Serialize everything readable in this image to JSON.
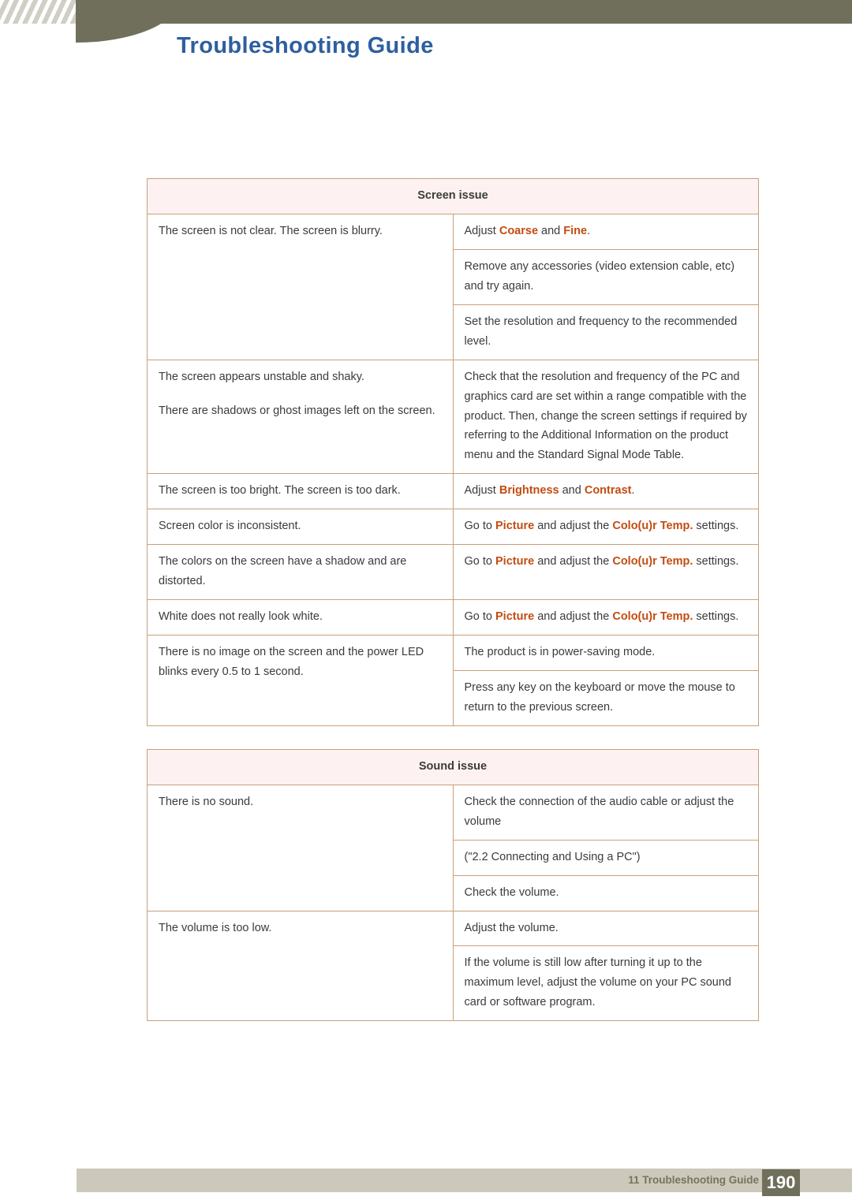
{
  "header": {
    "title": "Troubleshooting Guide"
  },
  "tables": [
    {
      "section": "Screen issue",
      "rows": [
        {
          "problem": [
            "The screen is not clear. The screen is blurry."
          ],
          "solutions": [
            [
              {
                "t": "Adjust ",
                "em": false
              },
              {
                "t": "Coarse",
                "em": true
              },
              {
                "t": " and ",
                "em": false
              },
              {
                "t": "Fine",
                "em": true
              },
              {
                "t": ".",
                "em": false
              }
            ],
            [
              {
                "t": "Remove any accessories (video extension cable, etc) and try again.",
                "em": false
              }
            ],
            [
              {
                "t": "Set the resolution and frequency to the recommended level.",
                "em": false
              }
            ]
          ]
        },
        {
          "problem": [
            "The screen appears unstable and shaky.",
            "There are shadows or ghost images left on the screen."
          ],
          "solutions": [
            [
              {
                "t": "Check that the resolution and frequency of the PC and graphics card are set within a range compatible with the product. Then, change the screen settings if required by referring to the Additional Information on the product menu and the Standard Signal Mode Table.",
                "em": false
              }
            ]
          ]
        },
        {
          "problem": [
            "The screen is too bright. The screen is too dark."
          ],
          "solutions": [
            [
              {
                "t": "Adjust ",
                "em": false
              },
              {
                "t": "Brightness",
                "em": true
              },
              {
                "t": " and ",
                "em": false
              },
              {
                "t": "Contrast",
                "em": true
              },
              {
                "t": ".",
                "em": false
              }
            ]
          ]
        },
        {
          "problem": [
            "Screen color is inconsistent."
          ],
          "solutions": [
            [
              {
                "t": "Go to ",
                "em": false
              },
              {
                "t": "Picture",
                "em": true
              },
              {
                "t": " and adjust the ",
                "em": false
              },
              {
                "t": "Colo(u)r Temp.",
                "em": true
              },
              {
                "t": " settings.",
                "em": false
              }
            ]
          ]
        },
        {
          "problem": [
            "The colors on the screen have a shadow and are distorted."
          ],
          "solutions": [
            [
              {
                "t": "Go to ",
                "em": false
              },
              {
                "t": "Picture",
                "em": true
              },
              {
                "t": " and adjust the ",
                "em": false
              },
              {
                "t": "Colo(u)r Temp.",
                "em": true
              },
              {
                "t": " settings.",
                "em": false
              }
            ]
          ]
        },
        {
          "problem": [
            "White does not really look white."
          ],
          "solutions": [
            [
              {
                "t": "Go to ",
                "em": false
              },
              {
                "t": "Picture",
                "em": true
              },
              {
                "t": " and adjust the ",
                "em": false
              },
              {
                "t": "Colo(u)r Temp.",
                "em": true
              },
              {
                "t": " settings.",
                "em": false
              }
            ]
          ]
        },
        {
          "problem": [
            "There is no image on the screen and the power LED blinks every 0.5 to 1 second."
          ],
          "solutions": [
            [
              {
                "t": "The product is in power-saving mode.",
                "em": false
              }
            ],
            [
              {
                "t": "Press any key on the keyboard or move the mouse to return to the previous screen.",
                "em": false
              }
            ]
          ]
        }
      ]
    },
    {
      "section": "Sound issue",
      "rows": [
        {
          "problem": [
            "There is no sound."
          ],
          "solutions": [
            [
              {
                "t": "Check the connection of the audio cable or adjust the volume",
                "em": false
              }
            ],
            [
              {
                "t": "(\"2.2 Connecting and Using a PC\")",
                "em": false
              }
            ],
            [
              {
                "t": "Check the volume.",
                "em": false
              }
            ]
          ]
        },
        {
          "problem": [
            "The volume is too low."
          ],
          "solutions": [
            [
              {
                "t": "Adjust the volume.",
                "em": false
              }
            ],
            [
              {
                "t": "If the volume is still low after turning it up to the maximum level, adjust the volume on your PC sound card or software program.",
                "em": false
              }
            ]
          ]
        }
      ]
    }
  ],
  "footer": {
    "label": "11 Troubleshooting Guide",
    "page": "190"
  }
}
